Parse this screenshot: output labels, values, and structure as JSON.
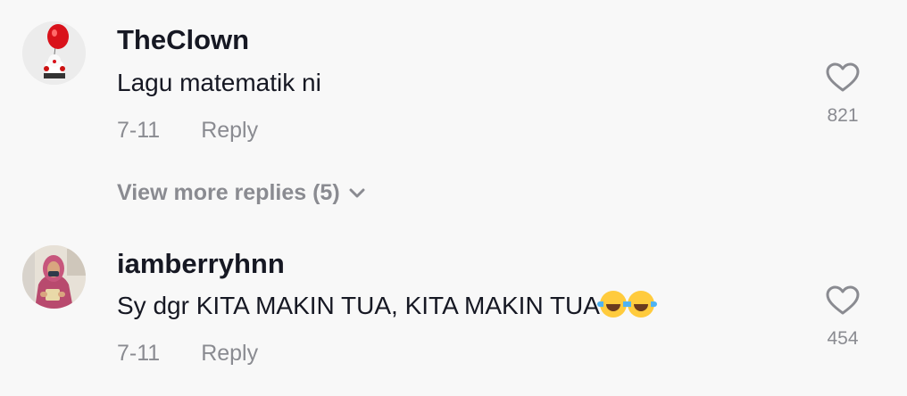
{
  "comments": [
    {
      "username": "TheClown",
      "text": "Lagu matematik ni",
      "date": "7-11",
      "reply_label": "Reply",
      "like_count": "821",
      "avatar_icon": "red-balloon-clown-avatar",
      "view_more_replies": "View more replies (5)"
    },
    {
      "username": "iamberryhnn",
      "text": "Sy dgr KITA MAKIN TUA, KITA MAKIN TUA",
      "emojis": "😂😂",
      "date": "7-11",
      "reply_label": "Reply",
      "like_count": "454",
      "avatar_icon": "hijab-woman-avatar"
    }
  ],
  "colors": {
    "background": "#f8f8f8",
    "primary_text": "#161823",
    "secondary_text": "#8a8b91"
  }
}
